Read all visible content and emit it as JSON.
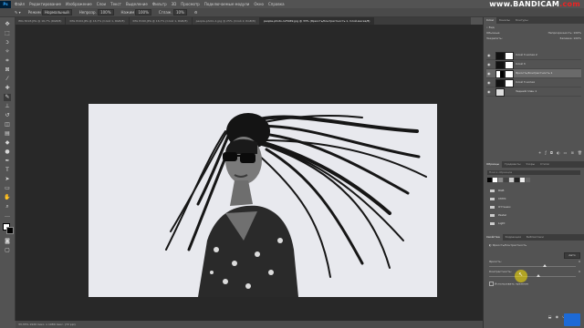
{
  "app": {
    "logo": "Ps"
  },
  "menu": [
    "Файл",
    "Редактирование",
    "Изображение",
    "Слои",
    "Текст",
    "Выделение",
    "Фильтр",
    "3D",
    "Просмотр",
    "Подключаемые модули",
    "Окно",
    "Справка"
  ],
  "watermark": {
    "part1": "www.",
    "part2": "BANDICAM",
    "part3": ".com"
  },
  "options": {
    "mode_label": "Режим",
    "mode_value": "Нормальный",
    "opacity_label": "Непрозр.",
    "opacity_value": "100%",
    "flow_label": "Нажим",
    "flow_value": "100%",
    "smooth_label": "Сглаж.",
    "smooth_value": "10%"
  },
  "tabs": [
    {
      "label": "IMG 8193.JPG @ 16,7% (RGB/8)",
      "active": false
    },
    {
      "label": "IMG 8194.JPG @ 16,7% (Слой 1, RGB/8)",
      "active": false
    },
    {
      "label": "IMG 8190.JPG @ 16,7% (Слой 1, RGB/8)",
      "active": false
    },
    {
      "label": "people-photo-1.jpg @ 25% (Слой 2, RGB/8)",
      "active": false
    },
    {
      "label": "people-photo-125049.jpg @ 33% (Яркость/Контрастность 1, Слой-маска/8)",
      "active": true
    }
  ],
  "status": "33,33%    1920 пикс. x 1080 пикс. (72 ppi)",
  "layers_panel": {
    "tabs": [
      "Слои",
      "Каналы",
      "Контуры"
    ],
    "kind_label": "Вид",
    "blend": "Обычные",
    "opacity_label": "Непрозрачность:",
    "opacity": "100%",
    "fill_label": "Заливка:",
    "fill": "100%",
    "lock_label": "Закрепить:",
    "layers": [
      {
        "name": "Слой 3 копия 2",
        "selected": false
      },
      {
        "name": "Слой 3",
        "selected": false
      },
      {
        "name": "Яркость/Контрастность 1",
        "selected": true
      },
      {
        "name": "Слой 3 копия",
        "selected": false
      },
      {
        "name": "Задний план 1",
        "selected": false
      }
    ]
  },
  "swatches_panel": {
    "tabs": [
      "Образцы",
      "Градиенты",
      "Узоры",
      "Стили"
    ],
    "search_placeholder": "Поиск образцов",
    "folders": [
      "RGB",
      "CMYK",
      "Оттенки",
      "Pastel",
      "Light"
    ]
  },
  "properties_panel": {
    "tabs": [
      "Свойства",
      "Коррекция",
      "Библиотеки"
    ],
    "title": "Яркость/Контрастность",
    "auto_button": "Авто",
    "brightness_label": "Яркость:",
    "brightness": "0",
    "contrast_label": "Контрастность:",
    "contrast": "0",
    "legacy_label": "Использовать прежние",
    "brightness_level": 0.62,
    "contrast_level": 0.55
  }
}
